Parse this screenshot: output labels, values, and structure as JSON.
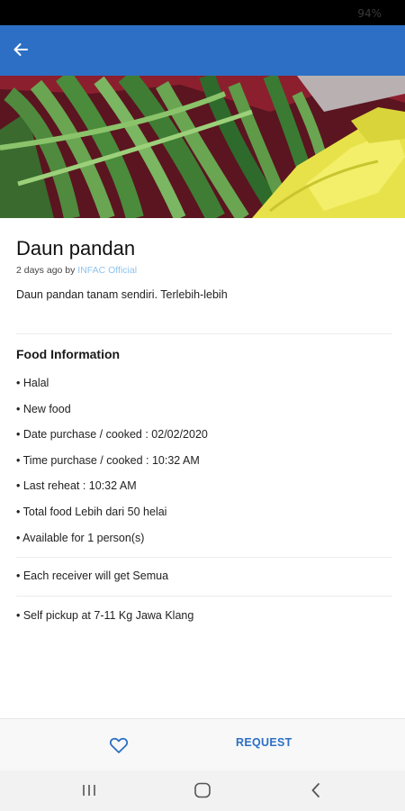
{
  "status_bar": {
    "battery": "94%"
  },
  "app_bar": {
    "back_icon": "arrow-left-icon",
    "color": "#2d6fc4"
  },
  "hero_image": {
    "subject": "pandan-leaves-photo"
  },
  "post": {
    "title": "Daun pandan",
    "time_prefix": "2 days ago by ",
    "author": "INFAC Official",
    "description": "Daun pandan tanam sendiri. Terlebih-lebih"
  },
  "food_info": {
    "heading": "Food Information",
    "items": [
      "• Halal",
      "• New food",
      "• Date purchase / cooked : 02/02/2020",
      "• Time purchase / cooked : 10:32 AM",
      "• Last reheat : 10:32 AM",
      "• Total food Lebih dari 50 helai",
      "• Available for 1 person(s)"
    ]
  },
  "receiver_info": "• Each receiver will get Semua",
  "pickup_info": "• Self pickup at 7-11 Kg Jawa Klang",
  "actions": {
    "favorite_icon": "heart-outline-icon",
    "request_label": "REQUEST",
    "accent": "#2d6fc4"
  },
  "system_nav": {
    "recents_icon": "recents-icon",
    "home_icon": "home-icon",
    "back_icon": "back-chevron-icon"
  }
}
